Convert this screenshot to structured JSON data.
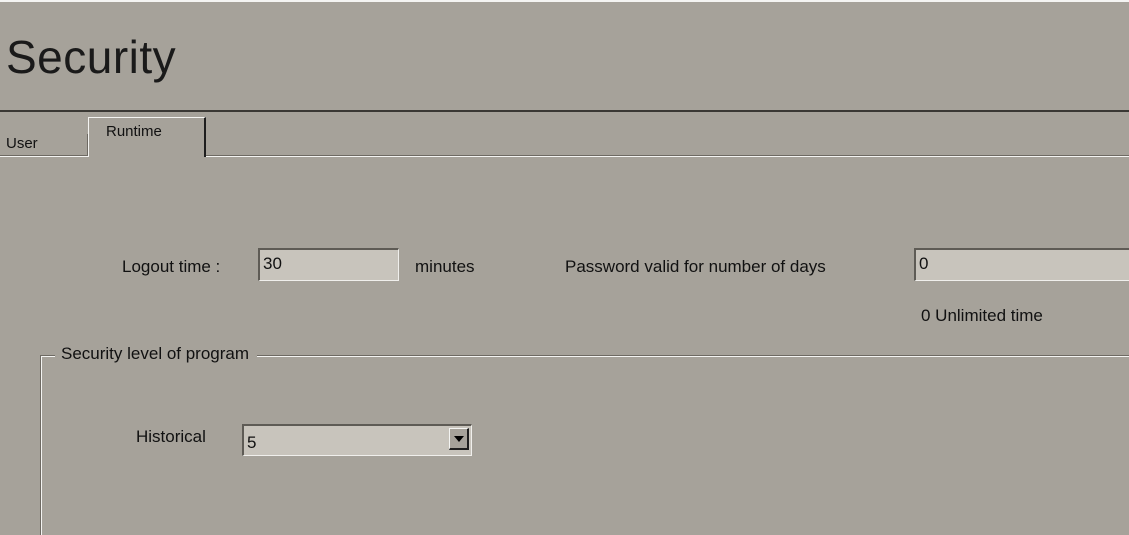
{
  "header": {
    "title": "Security"
  },
  "tabs": [
    {
      "label": "User"
    },
    {
      "label": "Runtime"
    }
  ],
  "runtime": {
    "logout_label": "Logout time :",
    "logout_value": "30",
    "logout_unit": "minutes",
    "password_label": "Password valid for number of days",
    "password_value": "0",
    "password_hint": "0 Unlimited time",
    "security_group": {
      "title": "Security level of program",
      "historical_label": "Historical",
      "historical_value": "5"
    }
  },
  "colors": {
    "background": "#a6a29a",
    "field": "#c8c4bc"
  }
}
